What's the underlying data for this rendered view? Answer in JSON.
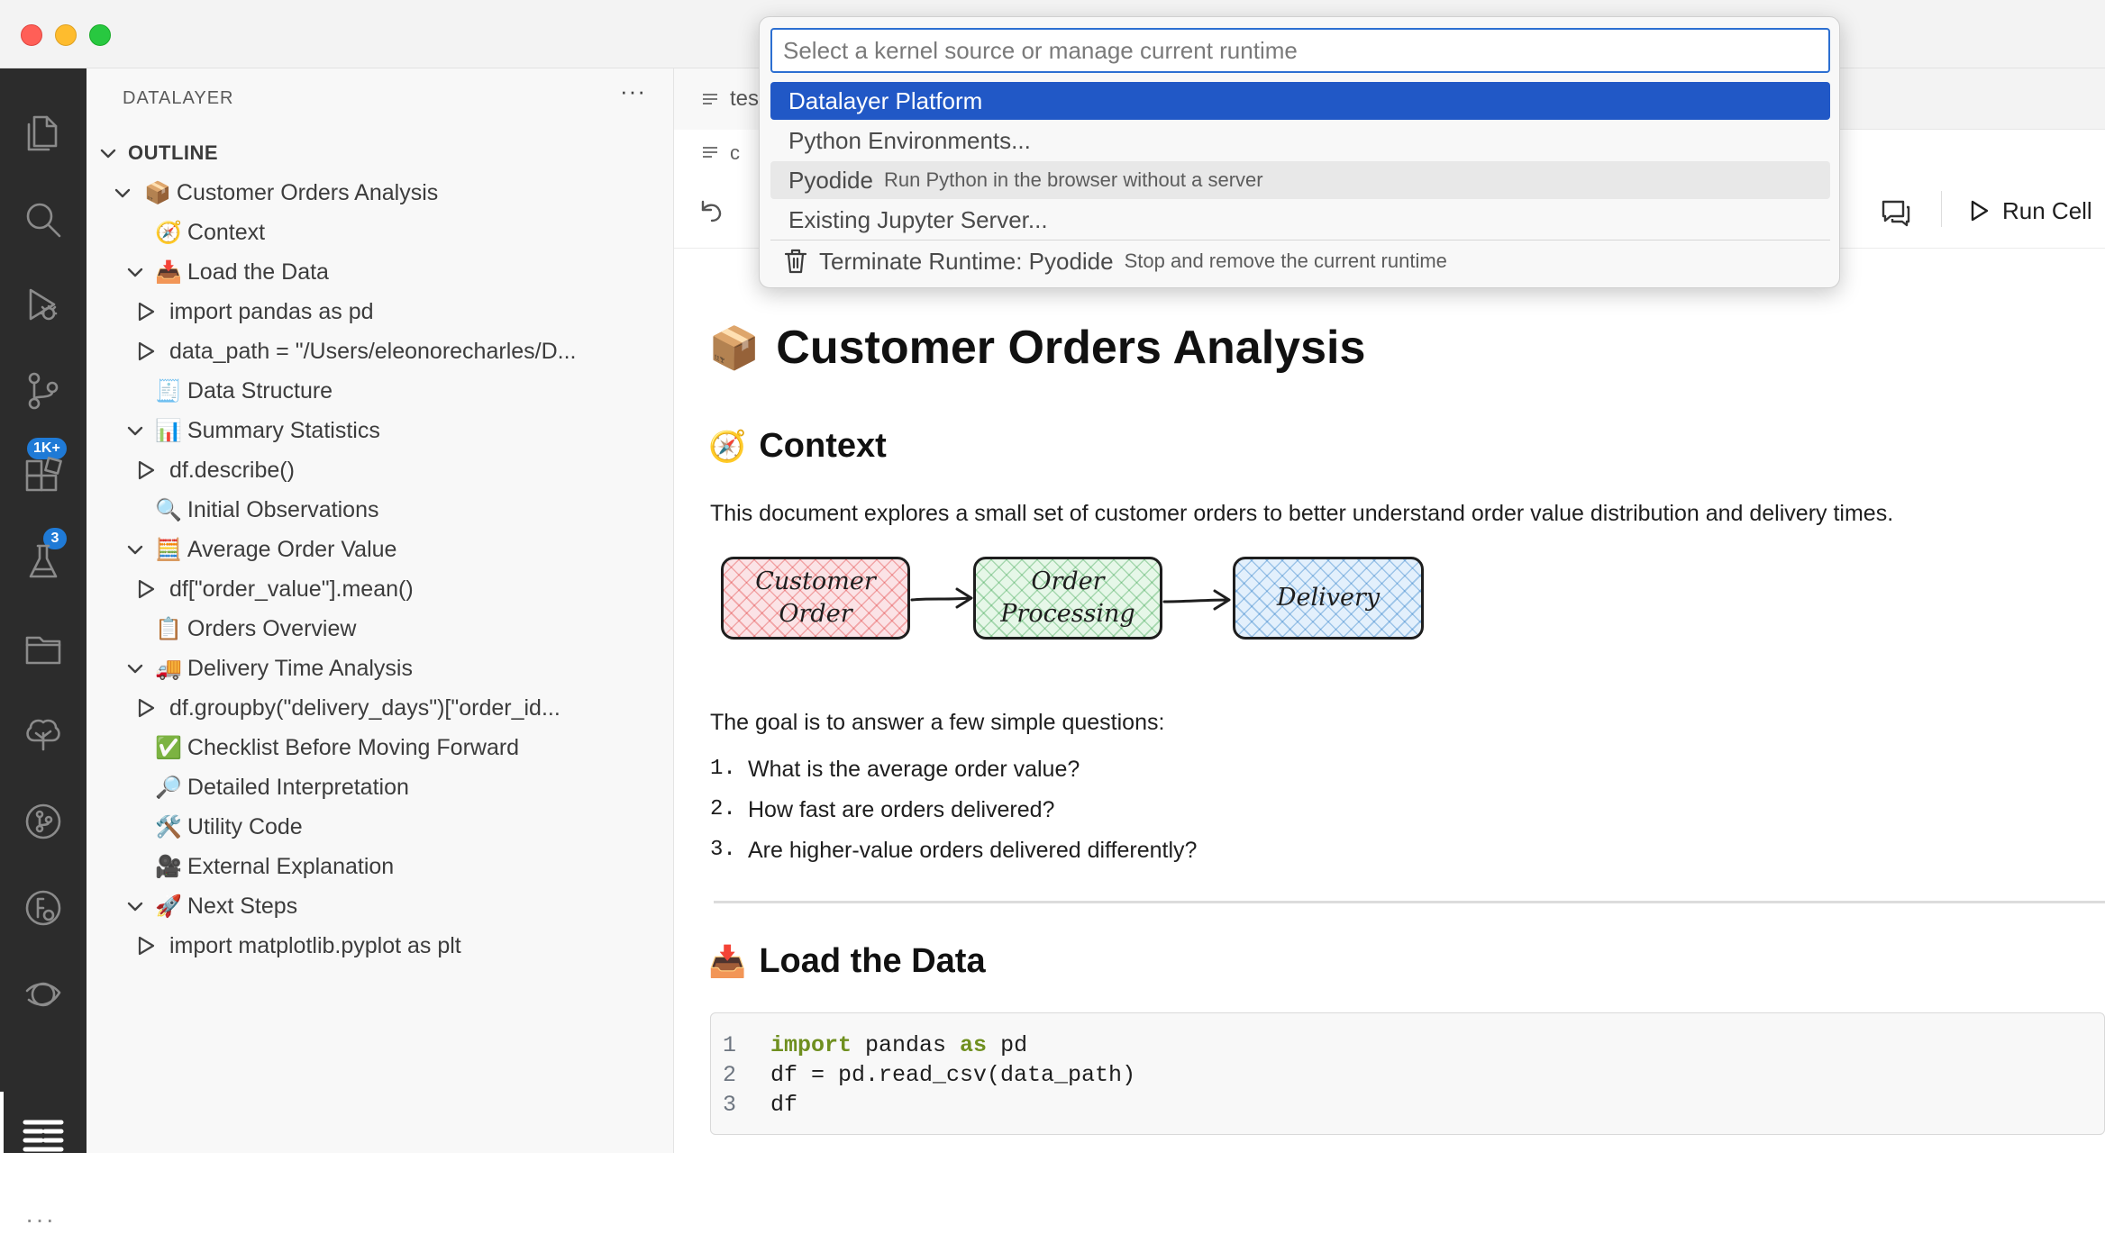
{
  "sidebar": {
    "title": "DATALAYER",
    "more": "···",
    "outline_label": "OUTLINE",
    "items": [
      {
        "label": "Customer Orders Analysis",
        "emoji": "📦"
      },
      {
        "label": "Context",
        "emoji": "🧭"
      },
      {
        "label": "Load the Data",
        "emoji": "📥"
      },
      {
        "label": "import pandas as pd"
      },
      {
        "label": "data_path = \"/Users/eleonorecharles/D..."
      },
      {
        "label": "Data Structure",
        "emoji": "🧾"
      },
      {
        "label": "Summary Statistics",
        "emoji": "📊"
      },
      {
        "label": "df.describe()"
      },
      {
        "label": "Initial Observations",
        "emoji": "🔍"
      },
      {
        "label": "Average Order Value",
        "emoji": "🧮"
      },
      {
        "label": "df[\"order_value\"].mean()"
      },
      {
        "label": "Orders Overview",
        "emoji": "📋"
      },
      {
        "label": "Delivery Time Analysis",
        "emoji": "🚚"
      },
      {
        "label": "df.groupby(\"delivery_days\")[\"order_id..."
      },
      {
        "label": "Checklist Before Moving Forward",
        "emoji": "✅"
      },
      {
        "label": "Detailed Interpretation",
        "emoji": "🔎"
      },
      {
        "label": "Utility Code",
        "emoji": "🛠️"
      },
      {
        "label": "External Explanation",
        "emoji": "🎥"
      },
      {
        "label": "Next Steps",
        "emoji": "🚀"
      },
      {
        "label": "import matplotlib.pyplot as plt"
      }
    ]
  },
  "activity": {
    "badges": {
      "source_control": "1K+",
      "extensions": "3"
    },
    "more": "···"
  },
  "editor": {
    "tab_label": "tes",
    "breadcrumb": "c",
    "run_cell_label": "Run Cell"
  },
  "notebook": {
    "title": "Customer Orders Analysis",
    "title_emoji": "📦",
    "context_heading": "Context",
    "context_emoji": "🧭",
    "intro": "This document explores a small set of customer orders to better understand order value distribution and delivery times.",
    "diagram": {
      "box1_line1": "Customer",
      "box1_line2": "Order",
      "box2_line1": "Order",
      "box2_line2": "Processing",
      "box3": "Delivery"
    },
    "goal": "The goal is to answer a few simple questions:",
    "questions": [
      {
        "num": "1.",
        "text": "What is the average order value?"
      },
      {
        "num": "2.",
        "text": "How fast are orders delivered?"
      },
      {
        "num": "3.",
        "text": "Are higher-value orders delivered differently?"
      }
    ],
    "load_heading": "Load the Data",
    "load_emoji": "📥",
    "code": {
      "l1_kw1": "import",
      "l1_mod": " pandas ",
      "l1_kw2": "as",
      "l1_alias": " pd",
      "l2": "df = pd.read_csv(data_path)",
      "l3": "df",
      "n1": "1",
      "n2": "2",
      "n3": "3"
    }
  },
  "quickpick": {
    "placeholder": "Select a kernel source or manage current runtime",
    "items": [
      {
        "label": "Datalayer Platform"
      },
      {
        "label": "Python Environments..."
      },
      {
        "label": "Pyodide",
        "desc": "Run Python in the browser without a server"
      },
      {
        "label": "Existing Jupyter Server..."
      },
      {
        "label": "Terminate Runtime: Pyodide",
        "desc": "Stop and remove the current runtime"
      }
    ]
  },
  "colors": {
    "accent": "#2158c6",
    "activity_bar": "#2c2c2c",
    "badge": "#1f7ad6",
    "keyword": "#6f8f1f"
  }
}
